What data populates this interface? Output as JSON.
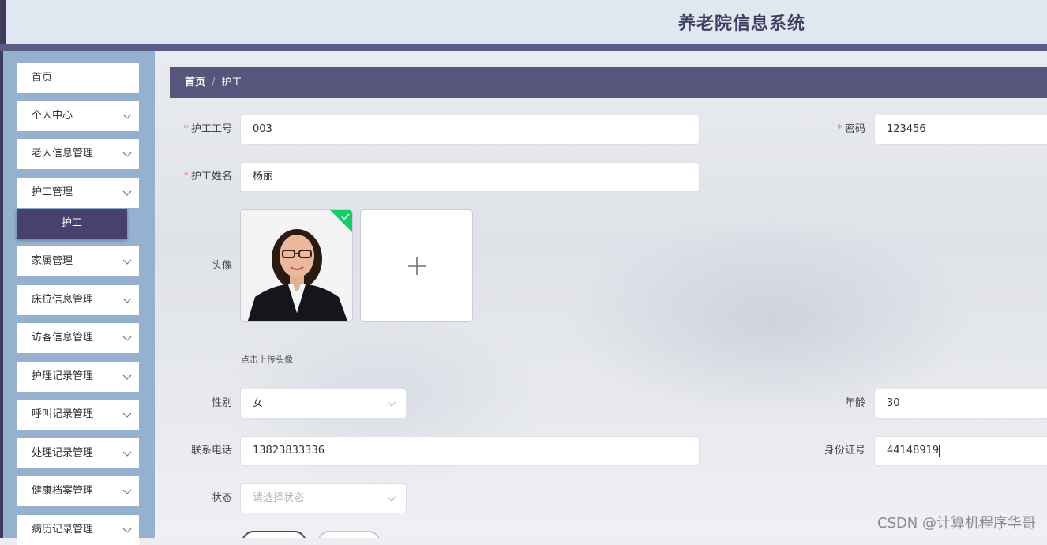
{
  "header": {
    "title": "养老院信息系统"
  },
  "sidebar": {
    "items": [
      {
        "label": "首页"
      },
      {
        "label": "个人中心"
      },
      {
        "label": "老人信息管理"
      },
      {
        "label": "护工管理"
      },
      {
        "label": "家属管理"
      },
      {
        "label": "床位信息管理"
      },
      {
        "label": "访客信息管理"
      },
      {
        "label": "护理记录管理"
      },
      {
        "label": "呼叫记录管理"
      },
      {
        "label": "处理记录管理"
      },
      {
        "label": "健康档案管理"
      },
      {
        "label": "病历记录管理"
      }
    ],
    "active_sub": "护工"
  },
  "breadcrumb": {
    "home": "首页",
    "separator": "/",
    "current": "护工"
  },
  "form": {
    "id_label": "护工工号",
    "id_value": "003",
    "password_label": "密码",
    "password_value": "123456",
    "name_label": "护工姓名",
    "name_value": "杨丽",
    "avatar_label": "头像",
    "upload_hint": "点击上传头像",
    "gender_label": "性别",
    "gender_value": "女",
    "age_label": "年龄",
    "age_value": "30",
    "phone_label": "联系电话",
    "phone_value": "13823833336",
    "idcard_label": "身份证号",
    "idcard_value": "44148919",
    "status_label": "状态",
    "status_placeholder": "请选择状态",
    "required_mark": "*"
  },
  "watermark": "CSDN @计算机程序华哥",
  "icons": {
    "chevron": "chevron-down-icon",
    "plus": "plus-icon",
    "check": "check-icon"
  },
  "colors": {
    "sidebar_bg": "#95b1cf",
    "accent": "#58557c",
    "header_bg": "#dfe8f0",
    "success": "#13ce66"
  }
}
